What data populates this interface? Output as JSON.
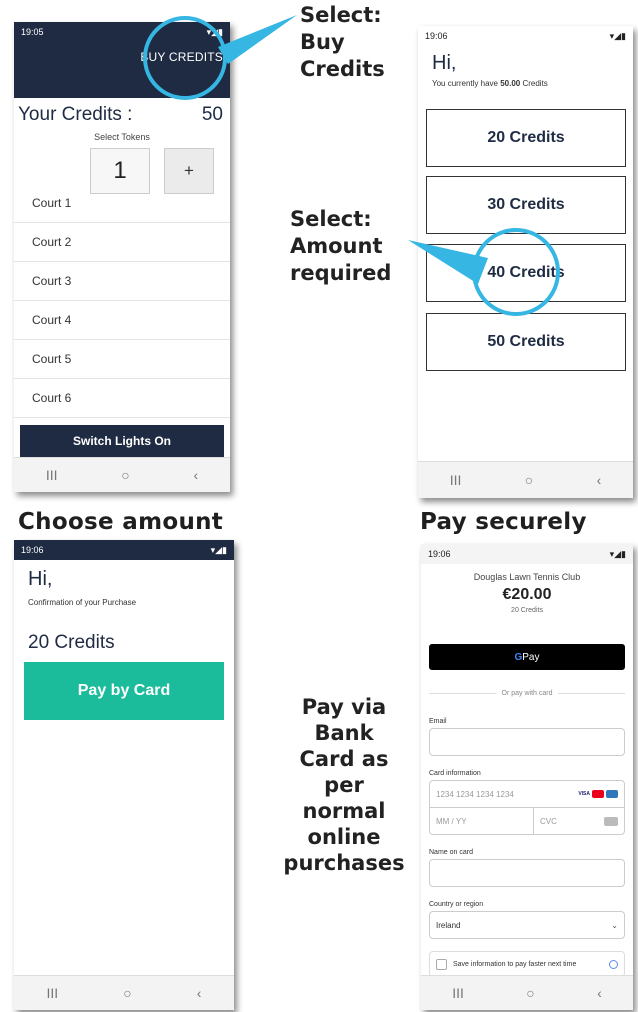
{
  "colors": {
    "navy": "#1f2b43",
    "callout": "#35b6e3",
    "teal": "#1abc9c"
  },
  "captions": {
    "choose": "Choose amount",
    "pay": "Pay securely"
  },
  "notes": {
    "buy": [
      "Select:",
      "Buy",
      "Credits"
    ],
    "amount": [
      "Select:",
      "Amount",
      "required"
    ],
    "card": [
      "Pay via",
      "Bank",
      "Card as",
      "per",
      "normal",
      "online",
      "purchases"
    ]
  },
  "screen1": {
    "time": "19:05",
    "buy_label": "BUY CREDITS",
    "credits_label": "Your Credits :",
    "credits_value": "50",
    "select_tokens": "Select Tokens",
    "token_value": "1",
    "plus": "+",
    "courts": [
      "Court 1",
      "Court 2",
      "Court 3",
      "Court 4",
      "Court 5",
      "Court 6"
    ],
    "switch_label": "Switch Lights On"
  },
  "screen2": {
    "time": "19:06",
    "greeting": "Hi,",
    "have_prefix": "You currently have ",
    "have_amount": "50.00",
    "have_suffix": " Credits",
    "options": [
      "20 Credits",
      "30 Credits",
      "40 Credits",
      "50 Credits"
    ]
  },
  "screen3": {
    "time": "19:06",
    "greeting": "Hi,",
    "confirm": "Confirmation of your Purchase",
    "credits": "20 Credits",
    "pay_button": "Pay by Card"
  },
  "screen4": {
    "time": "19:06",
    "merchant": "Douglas Lawn Tennis Club",
    "price": "€20.00",
    "product": "20 Credits",
    "gpay_g": "G",
    "gpay": " Pay",
    "or_pay": "Or pay with card",
    "email_label": "Email",
    "card_label": "Card information",
    "card_placeholder": "1234 1234 1234 1234",
    "visa": "VISA",
    "exp_placeholder": "MM / YY",
    "cvc_placeholder": "CVC",
    "name_label": "Name on card",
    "country_label": "Country or region",
    "country_value": "Ireland",
    "save_text": "Save information to pay faster next time"
  },
  "nav": {
    "recents": "III",
    "home": "○",
    "back": "‹"
  }
}
